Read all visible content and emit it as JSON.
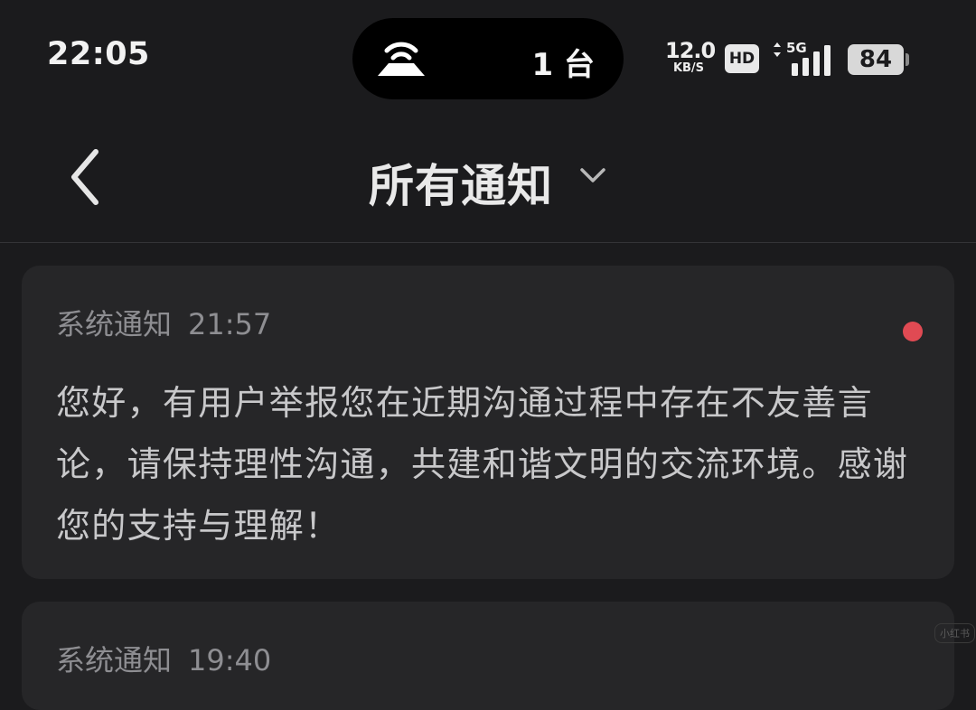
{
  "status_bar": {
    "time": "22:05",
    "island": {
      "wifi_icon": "wifi-router-icon",
      "devices": "1 台"
    },
    "net_speed": {
      "value": "12.0",
      "unit": "KB/S"
    },
    "hd_badge": "HD",
    "network": "5G",
    "battery": "84"
  },
  "header": {
    "title": "所有通知",
    "back_icon": "chevron-left-icon",
    "dropdown_icon": "chevron-down-icon"
  },
  "notifications": [
    {
      "source": "系统通知",
      "time": "21:57",
      "unread": true,
      "body": "您好，有用户举报您在近期沟通过程中存在不友善言论，请保持理性沟通，共建和谐文明的交流环境。感谢您的支持与理解！"
    },
    {
      "source": "系统通知",
      "time": "19:40"
    }
  ],
  "watermark": "小红书",
  "colors": {
    "background": "#1b1b1d",
    "card": "#262628",
    "unread_dot": "#e04a53",
    "meta_text": "#8e8e92"
  }
}
